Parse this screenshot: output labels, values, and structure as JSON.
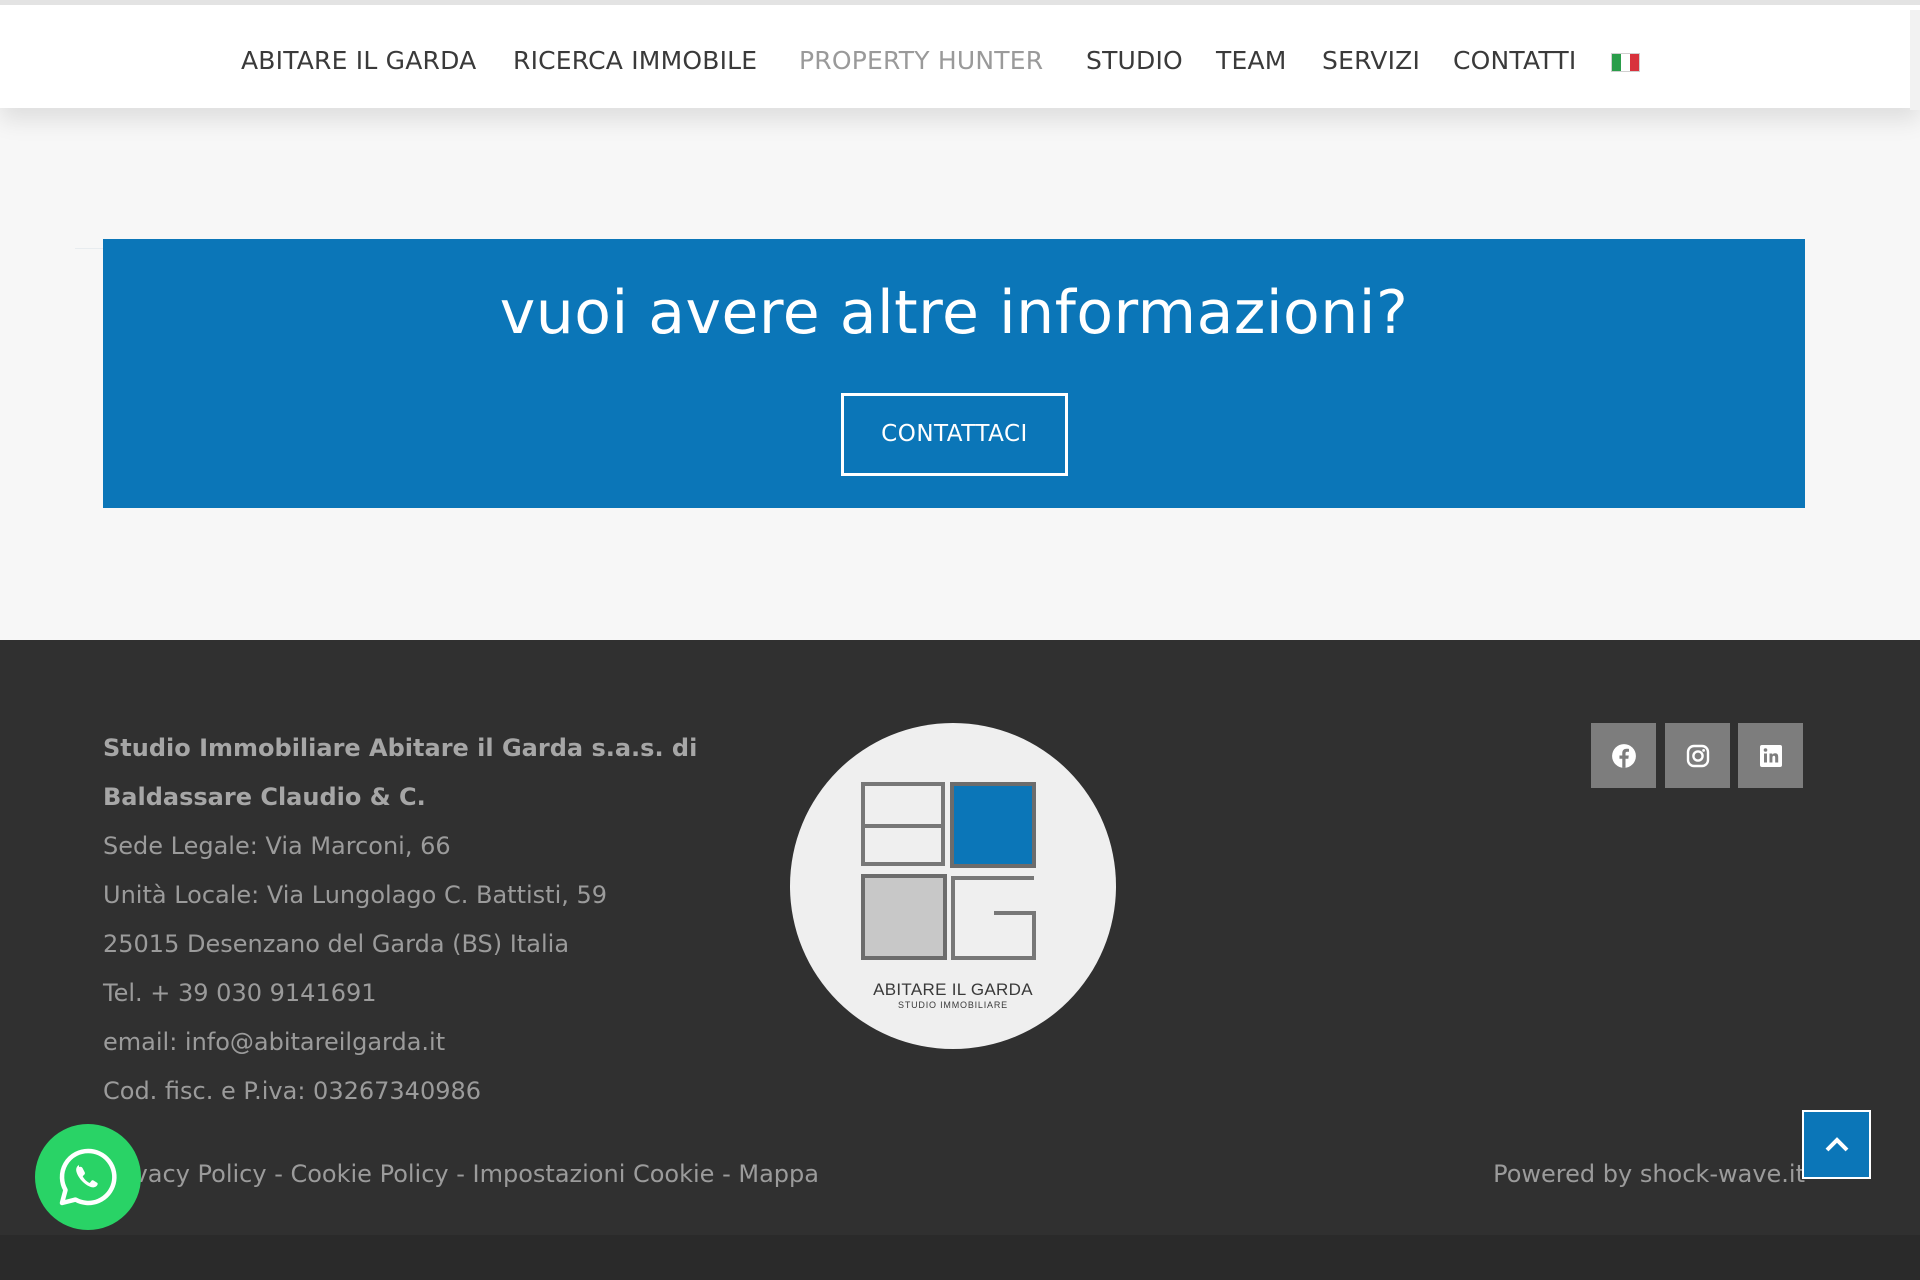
{
  "nav": {
    "items": [
      {
        "label": "ABITARE IL GARDA"
      },
      {
        "label": "RICERCA IMMOBILE"
      },
      {
        "label": "PROPERTY HUNTER"
      },
      {
        "label": "STUDIO"
      },
      {
        "label": "TEAM"
      },
      {
        "label": "SERVIZI"
      },
      {
        "label": "CONTATTI"
      }
    ],
    "active_item": "PROPERTY HUNTER",
    "language_icon": "italian-flag-icon"
  },
  "cta": {
    "title": "vuoi avere altre informazioni?",
    "button_label": "CONTATTACI"
  },
  "footer": {
    "company_line1": "Studio Immobiliare Abitare il Garda s.a.s. di",
    "company_line2": "Baldassare Claudio & C.",
    "address_legal": "Sede Legale: Via Marconi, 66",
    "address_local": "Unità Locale: Via Lungolago C. Battisti, 59",
    "city": "25015 Desenzano del Garda (BS) Italia",
    "phone": "Tel. + 39 030 9141691",
    "email": "email: info@abitareilgarda.it",
    "vat": "Cod. fisc. e P.iva: 03267340986",
    "logo_main": "ABITARE IL GARDA",
    "logo_sub": "STUDIO IMMOBILIARE",
    "links": {
      "privacy": "Privacy Policy",
      "cookie": "Cookie Policy",
      "cookie_settings": "Impostazioni Cookie",
      "map": "Mappa",
      "separator": " - "
    },
    "powered_by": "Powered by shock-wave.it",
    "social": [
      "facebook-icon",
      "instagram-icon",
      "linkedin-icon"
    ]
  },
  "colors": {
    "brand_blue": "#0b76b8",
    "footer_bg": "#303030",
    "whatsapp_green": "#29d366"
  }
}
